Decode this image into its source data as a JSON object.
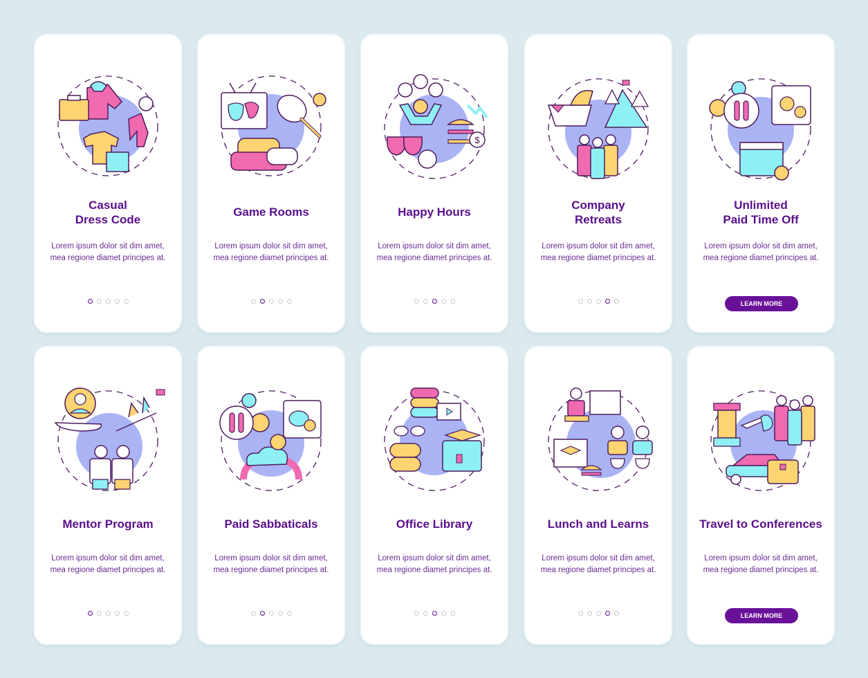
{
  "colors": {
    "background": "#dbeaef",
    "card": "#ffffff",
    "title": "#5a0f8c",
    "body_text": "#6a2a92",
    "button": "#6a1199",
    "dot_inactive": "#c9c9cf",
    "illus_blob": "#aab4f5",
    "illus_pink": "#f06aaf",
    "illus_yellow": "#fcd471",
    "illus_cyan": "#8ef0f5",
    "illus_outline": "#4d1a5c"
  },
  "cards": [
    {
      "title_lines": [
        "Casual",
        "Dress Code"
      ],
      "description": "Lorem ipsum dolor sit dim amet, mea regione diamet principes at.",
      "icon": "clothing-icon",
      "active_dot": 1,
      "total_dots": 5
    },
    {
      "title_lines": [
        "Game Rooms"
      ],
      "description": "Lorem ipsum dolor sit dim amet, mea regione diamet principes at.",
      "icon": "game-room-icon",
      "active_dot": 2,
      "total_dots": 5
    },
    {
      "title_lines": [
        "Happy Hours"
      ],
      "description": "Lorem ipsum dolor sit dim amet, mea regione diamet principes at.",
      "icon": "happy-hour-icon",
      "active_dot": 3,
      "total_dots": 5
    },
    {
      "title_lines": [
        "Company",
        "Retreats"
      ],
      "description": "Lorem ipsum dolor sit dim amet, mea regione diamet principes at.",
      "icon": "retreat-icon",
      "active_dot": 4,
      "total_dots": 5
    },
    {
      "title_lines": [
        "Unlimited",
        "Paid Time Off"
      ],
      "description": "Lorem ipsum dolor sit dim amet, mea regione diamet principes at.",
      "icon": "paid-time-off-icon",
      "button_label": "LEARN MORE"
    },
    {
      "title_lines": [
        "Mentor Program"
      ],
      "description": "Lorem ipsum dolor sit dim amet, mea regione diamet principes at.",
      "icon": "mentor-icon",
      "active_dot": 1,
      "total_dots": 5
    },
    {
      "title_lines": [
        "Paid Sabbaticals"
      ],
      "description": "Lorem ipsum dolor sit dim amet, mea regione diamet principes at.",
      "icon": "sabbatical-icon",
      "active_dot": 2,
      "total_dots": 5
    },
    {
      "title_lines": [
        "Office Library"
      ],
      "description": "Lorem ipsum dolor sit dim amet, mea regione diamet principes at.",
      "icon": "library-icon",
      "active_dot": 3,
      "total_dots": 5
    },
    {
      "title_lines": [
        "Lunch and Learns"
      ],
      "description": "Lorem ipsum dolor sit dim amet, mea regione diamet principes at.",
      "icon": "lunch-learn-icon",
      "active_dot": 4,
      "total_dots": 5
    },
    {
      "title_lines": [
        "Travel to Conferences"
      ],
      "description": "Lorem ipsum dolor sit dim amet, mea regione diamet principes at.",
      "icon": "travel-icon",
      "button_label": "LEARN MORE"
    }
  ]
}
